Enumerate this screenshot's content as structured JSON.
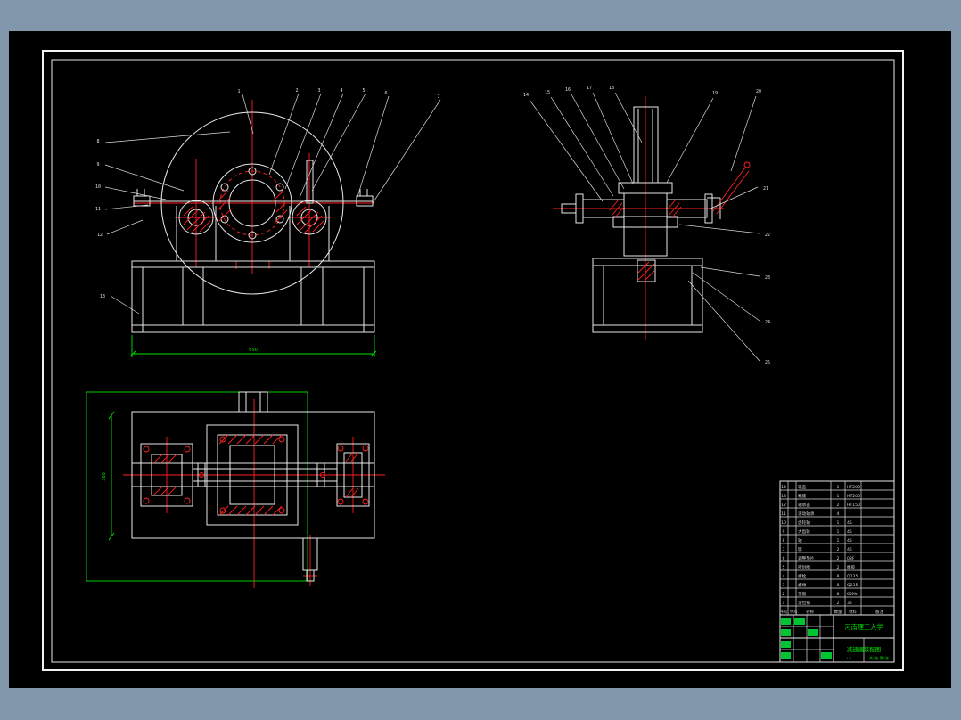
{
  "palette": {
    "surround": "#8297ac",
    "canvas": "#000000",
    "line_white": "#e9e9e9",
    "line_red": "#ff2020",
    "line_green": "#00e400"
  },
  "front_view": {
    "top_labels": [
      "1",
      "2",
      "3",
      "4",
      "5",
      "6",
      "7"
    ],
    "left_labels": [
      "8",
      "9",
      "10",
      "11",
      "12",
      "13"
    ],
    "dim_bottom": "650"
  },
  "side_view": {
    "top_labels": [
      "14",
      "15",
      "16",
      "17",
      "18",
      "19",
      "20"
    ],
    "right_labels": [
      "21",
      "22",
      "23",
      "24",
      "25"
    ]
  },
  "plan_view": {
    "dim_left": "360"
  },
  "title_block": {
    "header": [
      "序号",
      "代号",
      "名称",
      "数量",
      "材料",
      "备注"
    ],
    "parts": [
      {
        "no": "14",
        "name": "箱盖",
        "qty": "1",
        "mat": "HT200"
      },
      {
        "no": "13",
        "name": "箱座",
        "qty": "1",
        "mat": "HT200"
      },
      {
        "no": "12",
        "name": "轴承盖",
        "qty": "2",
        "mat": "HT150"
      },
      {
        "no": "11",
        "name": "滚动轴承",
        "qty": "4",
        "mat": ""
      },
      {
        "no": "10",
        "name": "齿轮轴",
        "qty": "1",
        "mat": "45"
      },
      {
        "no": "9",
        "name": "大齿轮",
        "qty": "1",
        "mat": "45"
      },
      {
        "no": "8",
        "name": "轴",
        "qty": "1",
        "mat": "45"
      },
      {
        "no": "7",
        "name": "键",
        "qty": "2",
        "mat": "45"
      },
      {
        "no": "6",
        "name": "调整垫片",
        "qty": "2",
        "mat": "08F"
      },
      {
        "no": "5",
        "name": "密封圈",
        "qty": "2",
        "mat": "橡胶"
      },
      {
        "no": "4",
        "name": "螺栓",
        "qty": "8",
        "mat": "Q235"
      },
      {
        "no": "3",
        "name": "螺母",
        "qty": "8",
        "mat": "Q235"
      },
      {
        "no": "2",
        "name": "垫圈",
        "qty": "8",
        "mat": "65Mn"
      },
      {
        "no": "1",
        "name": "定位销",
        "qty": "2",
        "mat": "35"
      }
    ],
    "university": "河南理工大学",
    "drawing_title": "减速器装配图",
    "scale": "1:2",
    "sheets": "共1张 第1张"
  }
}
